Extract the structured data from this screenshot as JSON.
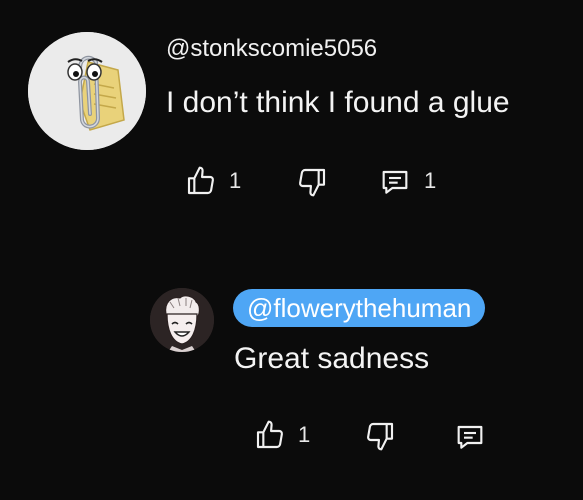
{
  "comment": {
    "author_handle": "@stonkscomie5056",
    "text": "I don’t think I found a glue",
    "like_count": "1",
    "reply_count": "1",
    "avatar_icon": "paperclip-assistant-icon"
  },
  "reply": {
    "author_handle": "@flowerythehuman",
    "text": "Great sadness",
    "like_count": "1",
    "avatar_icon": "cartoon-face-icon"
  },
  "colors": {
    "background": "#0b0b0b",
    "mention_highlight": "#4ea6f5",
    "text": "#f1f1f1"
  }
}
